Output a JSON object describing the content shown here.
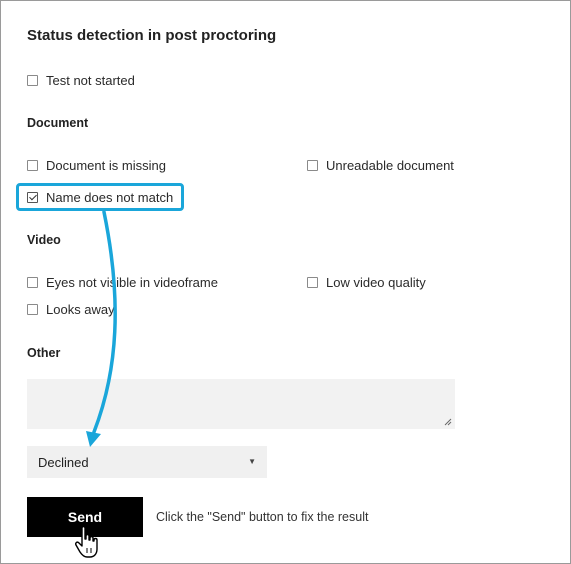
{
  "title": "Status detection in post proctoring",
  "general": {
    "test_not_started": "Test not started"
  },
  "document": {
    "heading": "Document",
    "missing": "Document is missing",
    "unreadable": "Unreadable document",
    "name_mismatch": "Name does not match"
  },
  "video": {
    "heading": "Video",
    "eyes": "Eyes not visible in videoframe",
    "low_quality": "Low video quality",
    "looks_away": "Looks away"
  },
  "other": {
    "heading": "Other",
    "comment_value": ""
  },
  "status_select": {
    "selected": "Declined"
  },
  "send_button": "Send",
  "hint": "Click the \"Send\" button to fix the result",
  "colors": {
    "accent": "#1aa6da",
    "button_bg": "#000000"
  },
  "icons": [
    "checkbox-icon",
    "caret-down-icon",
    "hand-cursor-icon",
    "arrow-icon"
  ]
}
